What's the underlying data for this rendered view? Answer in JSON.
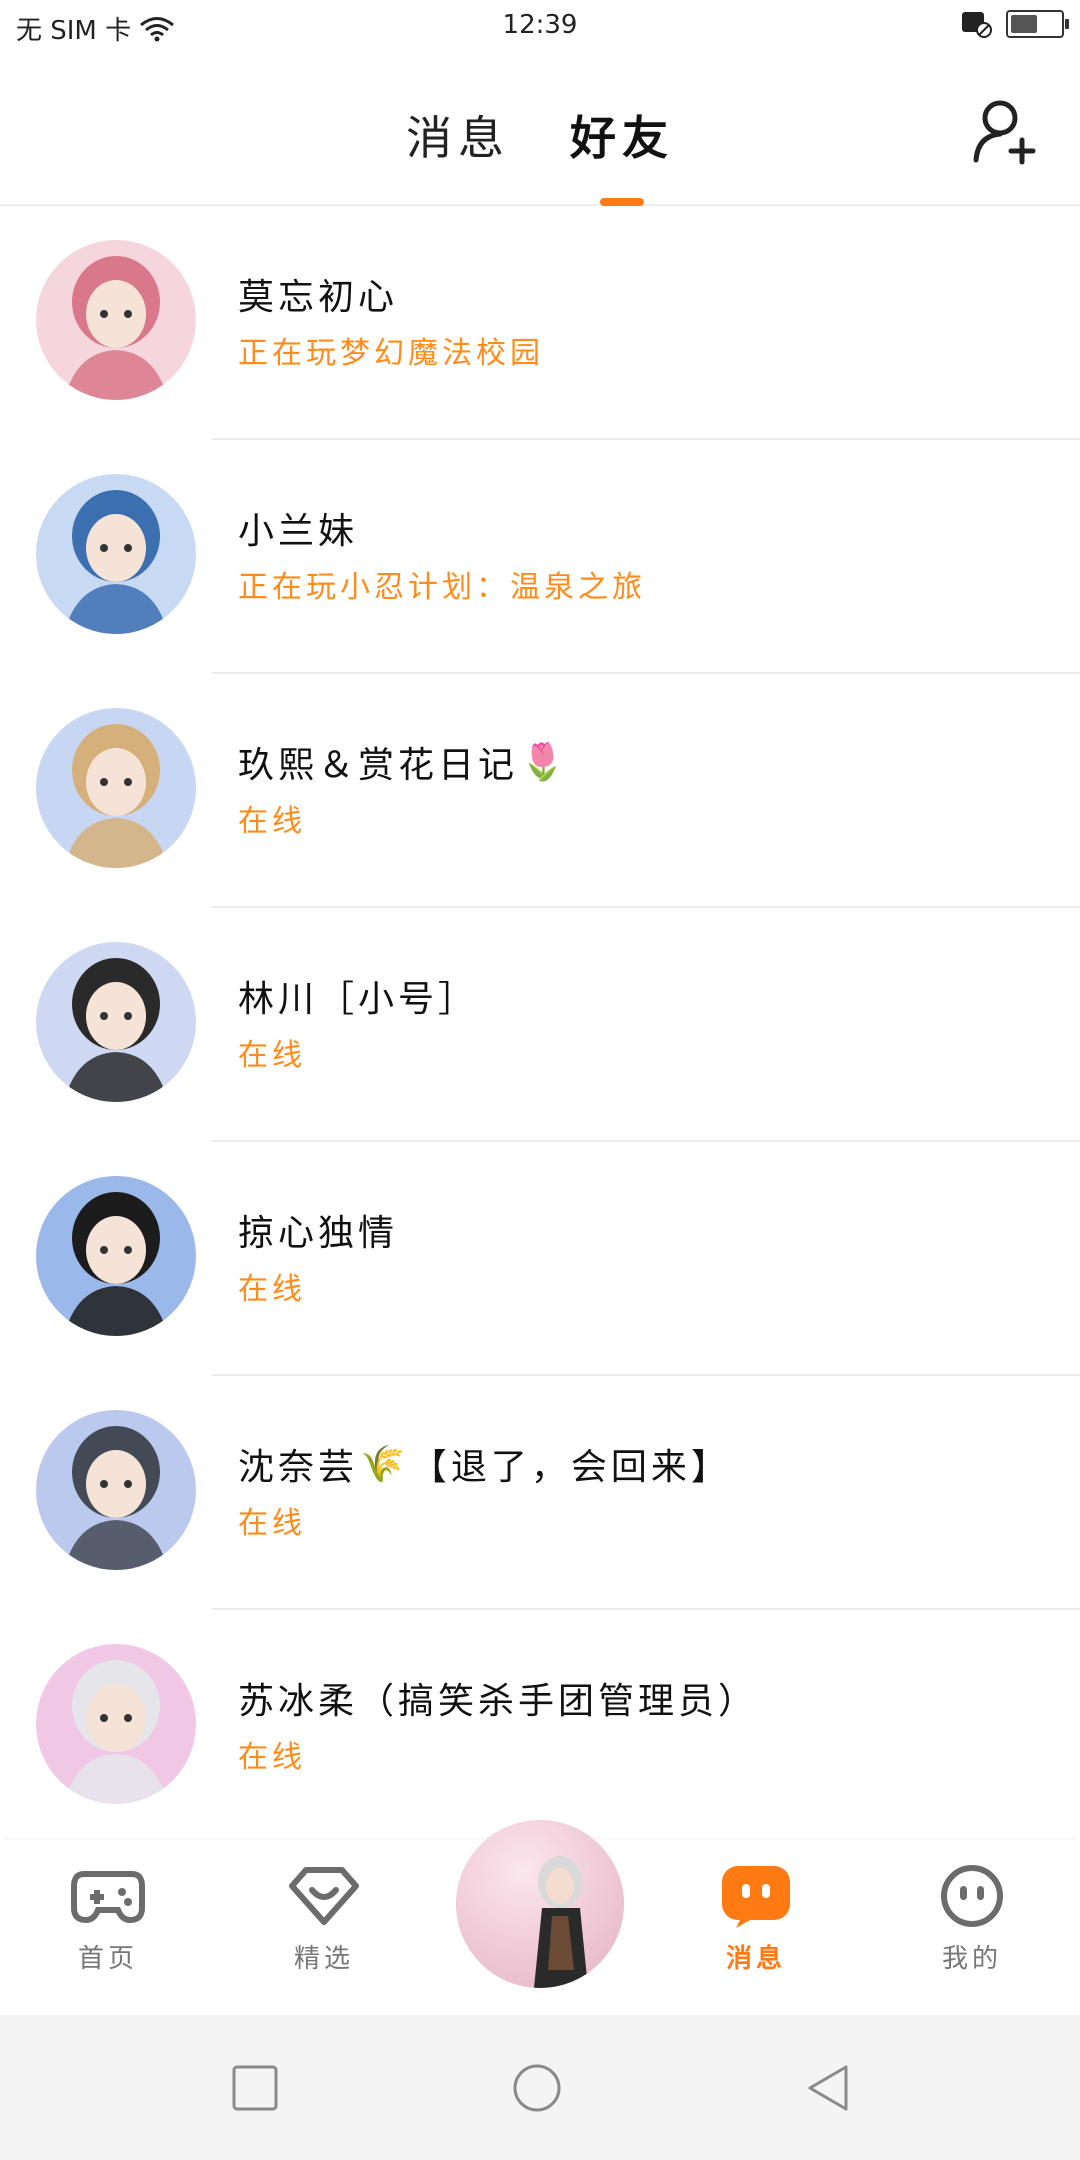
{
  "status_bar": {
    "carrier": "无 SIM 卡",
    "time": "12:39",
    "battery_level": 0.55
  },
  "header": {
    "tabs": [
      "消息",
      "好友"
    ],
    "active_tab": 1
  },
  "friends": [
    {
      "name": "莫忘初心",
      "emoji": "",
      "status": "正在玩梦幻魔法校园",
      "avatar_bg": "#f4d6dc",
      "avatar_fg": "#d9788a"
    },
    {
      "name": "小兰妹",
      "emoji": "",
      "status": "正在玩小忍计划：温泉之旅",
      "avatar_bg": "#c8d9f4",
      "avatar_fg": "#3b6fb0"
    },
    {
      "name": "玖熙＆赏花日记",
      "emoji": "🌷",
      "status": "在线",
      "avatar_bg": "#c7d6f2",
      "avatar_fg": "#d6b07a"
    },
    {
      "name": "林川［小号］",
      "emoji": "",
      "status": "在线",
      "avatar_bg": "#cfd8f3",
      "avatar_fg": "#2a2a2a"
    },
    {
      "name": "掠心独情",
      "emoji": "",
      "status": "在线",
      "avatar_bg": "#9bb8ea",
      "avatar_fg": "#1c1c1c"
    },
    {
      "name": "沈奈芸",
      "emoji": "🌾",
      "suffix": "【退了，会回来】",
      "status": "在线",
      "avatar_bg": "#bcc9ef",
      "avatar_fg": "#444a55"
    },
    {
      "name": "苏冰柔（搞笑杀手团管理员）",
      "emoji": "",
      "status": "在线",
      "avatar_bg": "#f0c8e6",
      "avatar_fg": "#e6e6ea"
    }
  ],
  "bottom_nav": [
    {
      "label": "首页",
      "icon": "gamepad-icon"
    },
    {
      "label": "精选",
      "icon": "heart-gem-icon"
    },
    {
      "label": "消息",
      "icon": "chat-bubble-icon"
    },
    {
      "label": "我的",
      "icon": "face-icon"
    }
  ],
  "colors": {
    "accent": "#ff7a12",
    "status_orange": "#ff8c1a",
    "nav_gray": "#777777"
  }
}
